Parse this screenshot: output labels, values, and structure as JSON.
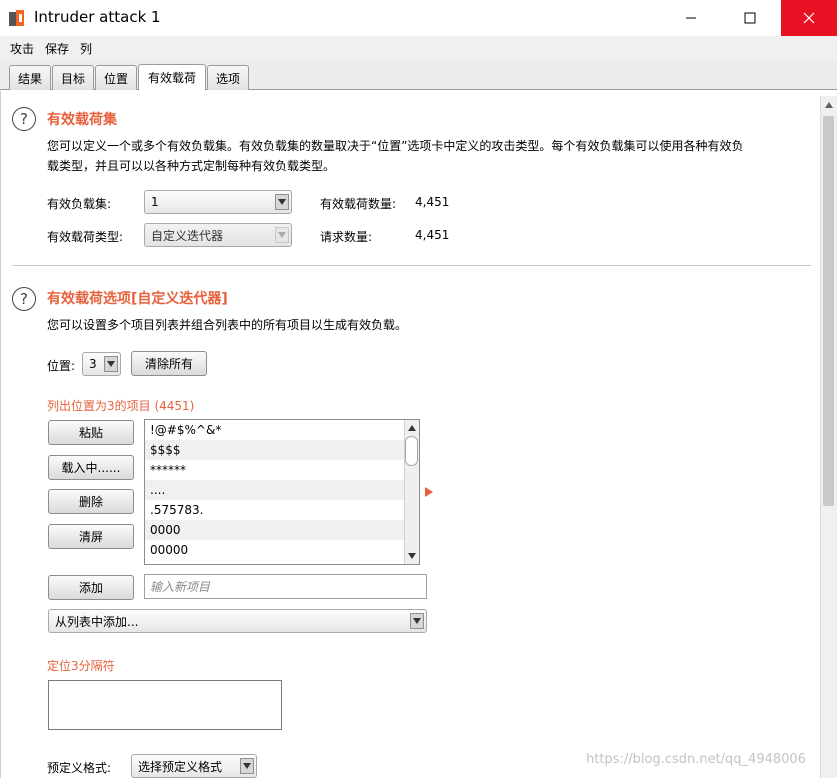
{
  "window": {
    "title": "Intruder attack 1",
    "controls": {
      "minimize": "—",
      "maximize": "☐",
      "close": "✕"
    },
    "close_color": "#e81123"
  },
  "menubar": {
    "items": [
      "攻击",
      "保存",
      "列"
    ]
  },
  "tabs": [
    {
      "label": "结果",
      "active": false
    },
    {
      "label": "目标",
      "active": false
    },
    {
      "label": "位置",
      "active": false
    },
    {
      "label": "有效载荷",
      "active": true
    },
    {
      "label": "选项",
      "active": false
    }
  ],
  "payload_sets": {
    "title": "有效载荷集",
    "description_line1": "您可以定义一个或多个有效负载集。有效负载集的数量取决于“位置”选项卡中定义的攻击类型。每个有效负载集可以使用各种有效负",
    "description_line2": "载类型，并且可以以各种方式定制每种有效负载类型。",
    "set_label": "有效负载集:",
    "set_value": "1",
    "type_label": "有效载荷类型:",
    "type_value": "自定义迭代器",
    "count_label": "有效载荷数量:",
    "count_value": "4,451",
    "request_label": "请求数量:",
    "request_value": "4,451"
  },
  "payload_options": {
    "title": "有效载荷选项[自定义迭代器]",
    "description": "您可以设置多个项目列表并组合列表中的所有项目以生成有效负载。",
    "position_label": "位置:",
    "position_value": "3",
    "clear_all_label": "清除所有",
    "list_heading": "列出位置为3的项目 (4451)",
    "buttons": {
      "paste": "粘贴",
      "load": "载入中......",
      "remove": "删除",
      "clear": "清屏",
      "add": "添加"
    },
    "items": [
      "!@#$%^&*",
      "$$$$",
      "******",
      "....",
      ".575783.",
      "0000",
      "00000"
    ],
    "new_item_placeholder": "输入新项目",
    "add_from_list_label": "从列表中添加...",
    "separator_heading": "定位3分隔符",
    "predefined_label": "预定义格式:",
    "predefined_value": "选择预定义格式"
  },
  "watermark": "https://blog.csdn.net/qq_4948006",
  "accent_color": "#e8613c"
}
